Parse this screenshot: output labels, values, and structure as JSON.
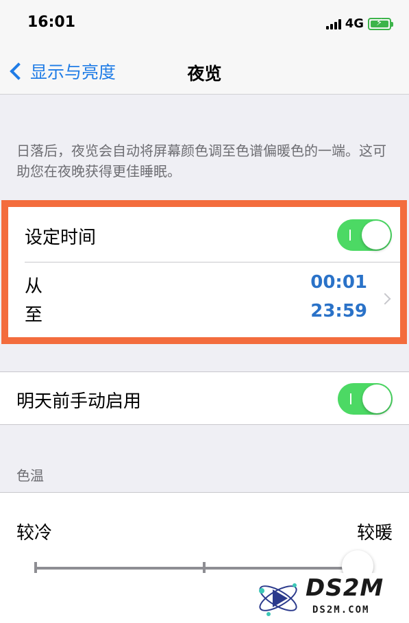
{
  "status_bar": {
    "time": "16:01",
    "network": "4G",
    "signal_icon": "signal-bars-icon",
    "battery_icon": "battery-charging-icon",
    "battery_level": 1.0,
    "battery_color": "#3cb44a"
  },
  "nav": {
    "back_label": "显示与亮度",
    "title": "夜览",
    "accent_color": "#1f7ce6"
  },
  "description": "日落后，夜览会自动将屏幕颜色调至色谱偏暖色的一端。这可助您在夜晚获得更佳睡眠。",
  "scheduled": {
    "label": "设定时间",
    "enabled": true,
    "from_label": "从",
    "to_label": "至",
    "from_time": "00:01",
    "to_time": "23:59",
    "highlight_color": "#f36c3d"
  },
  "manual": {
    "label": "明天前手动启用",
    "enabled": true
  },
  "color_temperature": {
    "header": "色温",
    "less_warm_label": "较冷",
    "more_warm_label": "较暖",
    "value": 1.0
  },
  "watermark": {
    "title": "DS2M",
    "subtitle": "DS2M.COM"
  }
}
